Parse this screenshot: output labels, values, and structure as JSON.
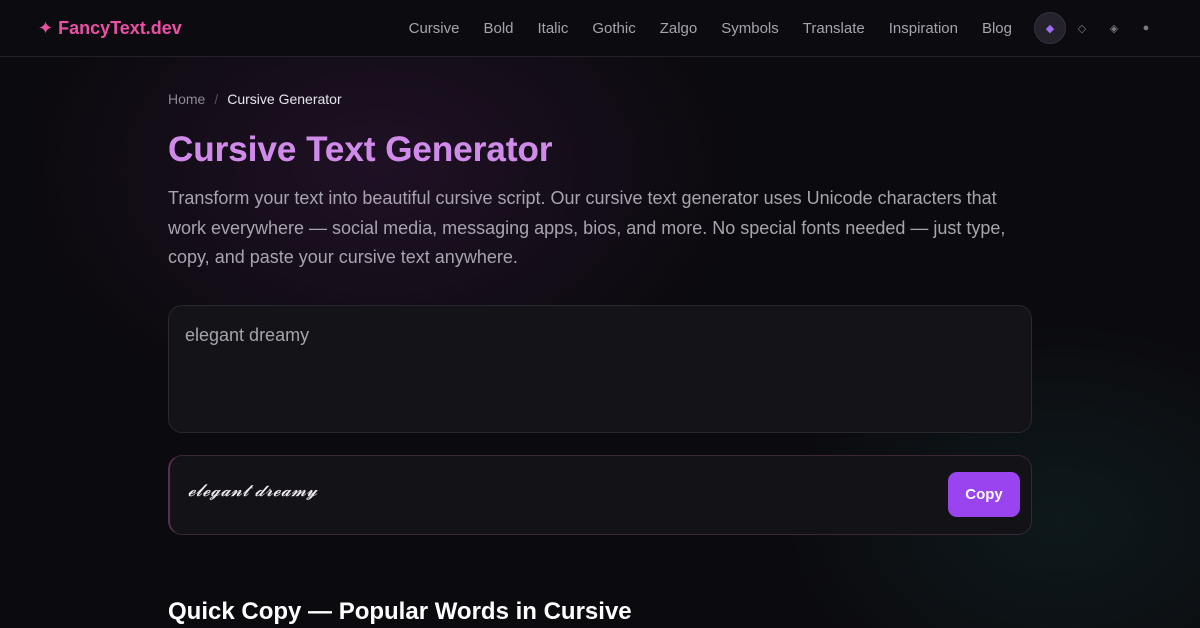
{
  "header": {
    "logo_icon": "✦",
    "logo_text": "FancyText.dev",
    "nav": [
      "Cursive",
      "Bold",
      "Italic",
      "Gothic",
      "Zalgo",
      "Symbols",
      "Translate",
      "Inspiration",
      "Blog"
    ],
    "theme_icons": [
      "◆",
      "◇",
      "◈",
      "●"
    ]
  },
  "breadcrumb": {
    "home": "Home",
    "separator": "/",
    "current": "Cursive Generator"
  },
  "page": {
    "title": "Cursive Text Generator",
    "description": "Transform your text into beautiful cursive script. Our cursive text generator uses Unicode characters that work everywhere — social media, messaging apps, bios, and more. No special fonts needed — just type, copy, and paste your cursive text anywhere."
  },
  "generator": {
    "input_value": "elegant dreamy",
    "output_text": "𝓮𝓵𝓮𝓰𝓪𝓷𝓽 𝓭𝓻𝓮𝓪𝓶𝔂",
    "copy_label": "Copy"
  },
  "quick_copy": {
    "heading": "Quick Copy — Popular Words in Cursive"
  },
  "colors": {
    "brand": "#ec4fa5",
    "title": "#d08ae9",
    "button": "#9a44f0"
  }
}
